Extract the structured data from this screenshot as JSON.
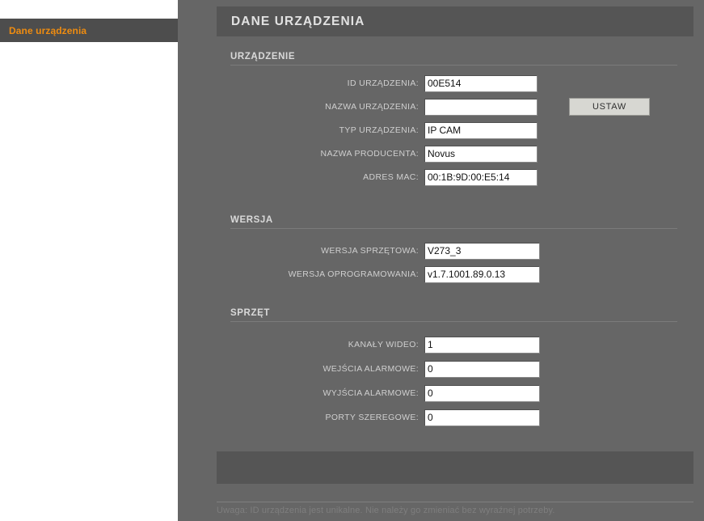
{
  "nav": {
    "items": [
      {
        "label": "Dane urządzenia",
        "active": true
      }
    ]
  },
  "header": {
    "title": "DANE URZĄDZENIA"
  },
  "sections": {
    "device": {
      "heading": "URZĄDZENIE",
      "rows": [
        {
          "label": "ID URZĄDZENIA:",
          "value": "00E514"
        },
        {
          "label": "NAZWA URZĄDZENIA:",
          "value": ""
        },
        {
          "label": "TYP URZĄDZENIA:",
          "value": "IP CAM"
        },
        {
          "label": "NAZWA PRODUCENTA:",
          "value": "Novus"
        },
        {
          "label": "ADRES MAC:",
          "value": "00:1B:9D:00:E5:14"
        }
      ],
      "set_button_label": "USTAW"
    },
    "version": {
      "heading": "WERSJA",
      "rows": [
        {
          "label": "WERSJA SPRZĘTOWA:",
          "value": "V273_3"
        },
        {
          "label": "WERSJA OPROGRAMOWANIA:",
          "value": "v1.7.1001.89.0.13"
        }
      ]
    },
    "hardware": {
      "heading": "SPRZĘT",
      "rows": [
        {
          "label": "KANAŁY WIDEO:",
          "value": "1"
        },
        {
          "label": "WEJŚCIA ALARMOWE:",
          "value": "0"
        },
        {
          "label": "WYJŚCIA ALARMOWE:",
          "value": "0"
        },
        {
          "label": "PORTY SZEREGOWE:",
          "value": "0"
        }
      ]
    }
  },
  "footer": {
    "note": "Uwaga: ID urządzenia jest unikalne. Nie należy go zmieniać bez wyraźnej potrzeby."
  },
  "colors": {
    "panel_bg": "#666666",
    "titlebar_bg": "#555555",
    "nav_item_bg": "#4d4d4d",
    "nav_item_text": "#ef8c10",
    "field_bg": "#ffffff",
    "button_bg": "#d7d7d2"
  }
}
